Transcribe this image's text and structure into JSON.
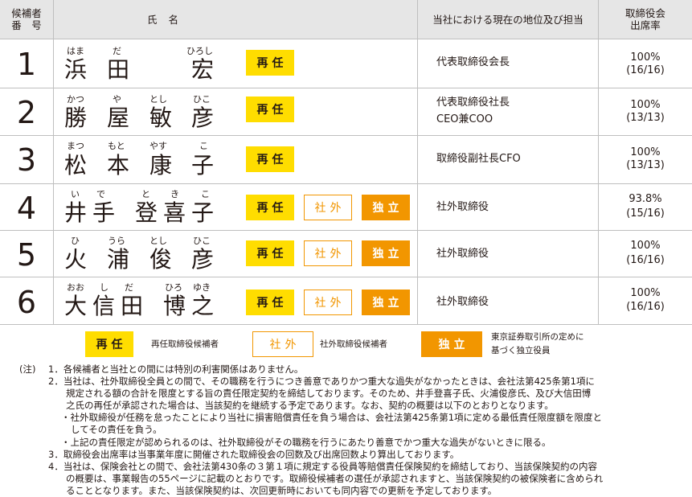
{
  "header": {
    "number": "候補者\n番　号",
    "name": "氏名",
    "position": "当社における現在の地位及び担当",
    "attendance": "取締役会\n出席率"
  },
  "badges": {
    "reappoint": "再任",
    "outside": "社外",
    "independent": "独立"
  },
  "candidates": [
    {
      "number": "1",
      "ruby": [
        "はま",
        "だ",
        "",
        "ひろし"
      ],
      "kanji": [
        "浜",
        "田",
        "",
        "宏"
      ],
      "position": [
        "代表取締役会長"
      ],
      "attendance": "100%",
      "meetings": "(16/16)"
    },
    {
      "number": "2",
      "ruby": [
        "かつ",
        "や",
        "とし",
        "ひこ"
      ],
      "kanji": [
        "勝",
        "屋",
        "敏",
        "彦"
      ],
      "position": [
        "代表取締役社長",
        "CEO兼COO"
      ],
      "attendance": "100%",
      "meetings": "(13/13)"
    },
    {
      "number": "3",
      "ruby": [
        "まつ",
        "もと",
        "やす",
        "こ"
      ],
      "kanji": [
        "松",
        "本",
        "康",
        "子"
      ],
      "position": [
        "取締役副社長CFO"
      ],
      "attendance": "100%",
      "meetings": "(13/13)"
    },
    {
      "number": "4",
      "ruby": [
        "い",
        "で",
        "と",
        "き",
        "こ"
      ],
      "kanji": [
        "井",
        "手",
        "登",
        "喜",
        "子"
      ],
      "position": [
        "社外取締役"
      ],
      "attendance": "93.8%",
      "meetings": "(15/16)"
    },
    {
      "number": "5",
      "ruby": [
        "ひ",
        "うら",
        "とし",
        "ひこ"
      ],
      "kanji": [
        "火",
        "浦",
        "俊",
        "彦"
      ],
      "position": [
        "社外取締役"
      ],
      "attendance": "100%",
      "meetings": "(16/16)"
    },
    {
      "number": "6",
      "ruby": [
        "おお",
        "し",
        "だ",
        "ひろ",
        "ゆき"
      ],
      "kanji": [
        "大",
        "信",
        "田",
        "博",
        "之"
      ],
      "position": [
        "社外取締役"
      ],
      "attendance": "100%",
      "meetings": "(16/16)"
    }
  ],
  "legend": {
    "reappoint": "再任取締役候補者",
    "outside": "社外取締役候補者",
    "independent_1": "東京証券取引所の定めに",
    "independent_2": "基づく独立役員"
  },
  "notes": {
    "prefix": "(注)",
    "n1": "1．各候補者と当社との間には特別の利害関係はありません。",
    "n2_1": "2．当社は、社外取締役全員との間で、その職務を行うにつき善意でありかつ重大な過失がなかったときは、会社法第425条第1項に",
    "n2_2": "規定される額の合計を限度とする旨の責任限定契約を締結しております。そのため、井手登喜子氏、火浦俊彦氏、及び大信田博",
    "n2_3": "之氏の再任が承認された場合は、当該契約を継続する予定であります。なお、契約の概要は以下のとおりとなります。",
    "n2_4": "・社外取締役が任務を怠ったことにより当社に損害賠償責任を負う場合は、会社法第425条第1項に定める最低責任限度額を限度と",
    "n2_5": "してその責任を負う。",
    "n2_6": "・上記の責任限定が認められるのは、社外取締役がその職務を行うにあたり善意でかつ重大な過失がないときに限る。",
    "n3": "3．取締役会出席率は当事業年度に開催された取締役会の回数及び出席回数より算出しております。",
    "n4_1": "4．当社は、保険会社との間で、会社法第430条の３第１項に規定する役員等賠償責任保険契約を締結しており、当該保険契約の内容",
    "n4_2": "の概要は、事業報告の55ページに記載のとおりです。取締役候補者の選任が承認されますと、当該保険契約の被保険者に含められ",
    "n4_3": "ることとなります。また、当該保険契約は、次回更新時においても同内容での更新を予定しております。"
  }
}
